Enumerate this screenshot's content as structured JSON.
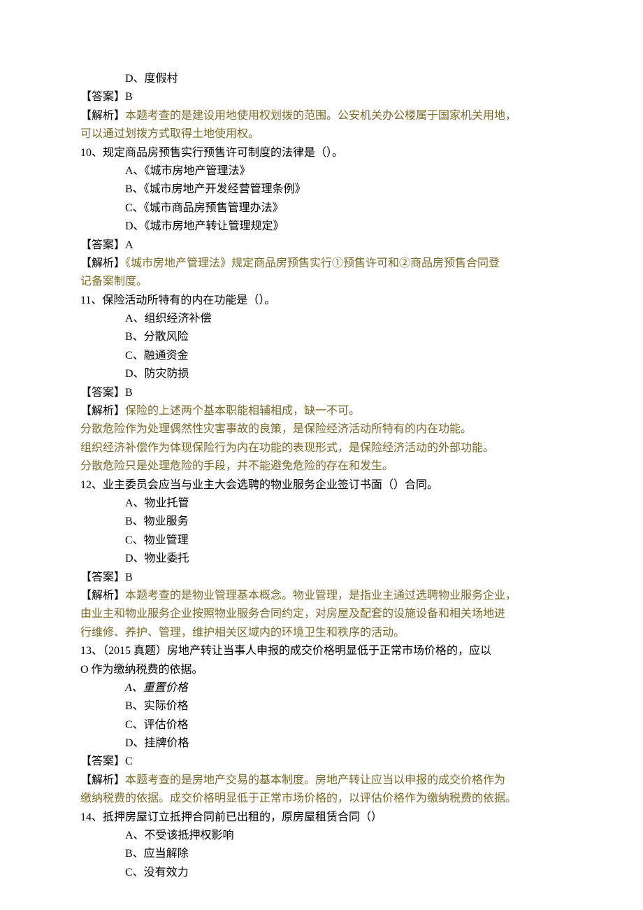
{
  "q9": {
    "optD": "D、度假村",
    "ans_label": "【答案】",
    "ans_val": "B",
    "jiexi_label": "【解析】",
    "jiexi_text": "本题考查的是建设用地使用权划拨的范围。公安机关办公楼属于国家机关用地，",
    "jiexi_text2": "可以通过划拨方式取得土地使用权。"
  },
  "q10": {
    "stem": "10、规定商品房预售实行预售许可制度的法律是（）。",
    "optA": "A、《城市房地产管理法》",
    "optB": "B、《城市房地产开发经营管理条例》",
    "optC": "C、《城市商品房预售管理办法》",
    "optD": "D、《城市房地产转让管理规定》",
    "ans_label": "【答案】",
    "ans_val": "A",
    "jiexi_label": "【解析】",
    "jiexi_text": "《城市房地产管理法》规定商品房预售实行①预售许可和②商品房预售合同登",
    "jiexi_text2": "记备案制度。"
  },
  "q11": {
    "stem": "11、保险活动所特有的内在功能是（）。",
    "optA": "A、组织经济补偿",
    "optB": "B、分散风险",
    "optC": "C、融通资金",
    "optD": "D、防灾防损",
    "ans_label": "【答案】",
    "ans_val": "B",
    "jiexi_label": "【解析】",
    "jiexi_text": "保险的上述两个基本职能相辅相成，缺一不可。",
    "jiexi_l2": "分散危险作为处理偶然性灾害事故的良策，是保险经济活动所特有的内在功能。",
    "jiexi_l3": "组织经济补偿作为体现保险行为内在功能的表现形式，是保险经济活动的外部功能。",
    "jiexi_l4": "分散危险只是处理危险的手段，并不能避免危险的存在和发生。"
  },
  "q12": {
    "stem": "12、业主委员会应当与业主大会选聘的物业服务企业签订书面（）合同。",
    "optA": "A、物业托管",
    "optB": "B、物业服务",
    "optC": "C、物业管理",
    "optD": "D、物业委托",
    "ans_label": "【答案】",
    "ans_val": "B",
    "jiexi_label": "【解析】",
    "jiexi_text": "本题考查的是物业管理基本概念。物业管理，是指业主通过选聘物业服务企业，",
    "jiexi_l2": "由业主和物业服务企业按照物业服务合同约定，对房屋及配套的设施设备和相关场地进",
    "jiexi_l3": "行维修、养护、管理，维护相关区域内的环境卫生和秩序的活动。"
  },
  "q13": {
    "stem": "13、（2015 真题）房地产转让当事人申报的成交价格明显低于正常市场价格的，应以",
    "stem2": "O 作为缴纳税费的依据。",
    "optA": "A、重置价格",
    "optB": "B、实际价格",
    "optC": "C、评估价格",
    "optD": "D、挂牌价格",
    "ans_label": "【答案】",
    "ans_val": "C",
    "jiexi_label": "【解析】",
    "jiexi_text": "本题考查的是房地产交易的基本制度。房地产转让应当以申报的成交价格作为",
    "jiexi_l2": "缴纳税费的依据。成交价格明显低于正常市场价格的，以评估价格作为缴纳税费的依据。"
  },
  "q14": {
    "stem": "14、抵押房屋订立抵押合同前已出租的，原房屋租赁合同（）",
    "optA": "A、不受该抵押权影响",
    "optB": "B、应当解除",
    "optC": "C、没有效力"
  }
}
